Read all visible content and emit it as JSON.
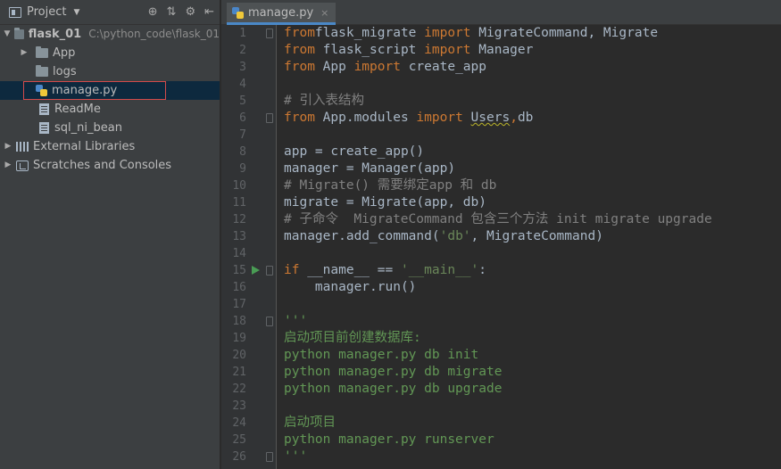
{
  "project_panel": {
    "title": "Project",
    "tools": [
      "⊕",
      "⇅",
      "⚙",
      "⇤"
    ],
    "tree": [
      {
        "label": "flask_01",
        "sub": "C:\\python_code\\flask_01",
        "type": "root"
      },
      {
        "label": "App",
        "type": "folder"
      },
      {
        "label": "logs",
        "type": "folder"
      },
      {
        "label": "manage.py",
        "type": "py",
        "selected": true
      },
      {
        "label": "ReadMe",
        "type": "file"
      },
      {
        "label": "sql_ni_bean",
        "type": "file"
      },
      {
        "label": "External Libraries",
        "type": "libs"
      },
      {
        "label": "Scratches and Consoles",
        "type": "scratches"
      }
    ]
  },
  "editor": {
    "tab": {
      "label": "manage.py",
      "close": "×"
    },
    "lines": [
      {
        "n": "1",
        "parts": [
          [
            "kw",
            "from"
          ],
          [
            "",
            "flask_migrate "
          ],
          [
            "kw",
            "import"
          ],
          [
            "",
            " MigrateCommand, Migrate"
          ]
        ]
      },
      {
        "n": "2",
        "parts": [
          [
            "kw",
            "from"
          ],
          [
            "",
            " flask_script "
          ],
          [
            "kw",
            "import"
          ],
          [
            "",
            " Manager"
          ]
        ]
      },
      {
        "n": "3",
        "parts": [
          [
            "kw",
            "from"
          ],
          [
            "",
            " App "
          ],
          [
            "kw",
            "import"
          ],
          [
            "",
            " create_app"
          ]
        ]
      },
      {
        "n": "4",
        "parts": []
      },
      {
        "n": "5",
        "parts": [
          [
            "cm",
            "# 引入表结构"
          ]
        ]
      },
      {
        "n": "6",
        "parts": [
          [
            "kw",
            "from"
          ],
          [
            "",
            " App.modules "
          ],
          [
            "kw",
            "import"
          ],
          [
            "",
            " "
          ],
          [
            "sq",
            "Users"
          ],
          [
            "kw",
            ","
          ],
          [
            "",
            "db"
          ]
        ]
      },
      {
        "n": "7",
        "parts": []
      },
      {
        "n": "8",
        "parts": [
          [
            "",
            "app = create_app()"
          ]
        ]
      },
      {
        "n": "9",
        "parts": [
          [
            "",
            "manager = Manager(app)"
          ]
        ]
      },
      {
        "n": "10",
        "parts": [
          [
            "cm",
            "# Migrate() 需要绑定app 和 db"
          ]
        ]
      },
      {
        "n": "11",
        "parts": [
          [
            "",
            "migrate = Migrate(app, db)"
          ]
        ]
      },
      {
        "n": "12",
        "parts": [
          [
            "cm",
            "# 子命令  MigrateCommand 包含三个方法 init migrate upgrade"
          ]
        ]
      },
      {
        "n": "13",
        "parts": [
          [
            "",
            "manager.add_command("
          ],
          [
            "str",
            "'db'"
          ],
          [
            "",
            ", MigrateCommand)"
          ]
        ]
      },
      {
        "n": "14",
        "parts": []
      },
      {
        "n": "15",
        "parts": [
          [
            "kw",
            "if"
          ],
          [
            "",
            " __name__ == "
          ],
          [
            "str",
            "'__main__'"
          ],
          [
            "",
            ":"
          ]
        ]
      },
      {
        "n": "16",
        "parts": [
          [
            "",
            "    manager.run()"
          ]
        ]
      },
      {
        "n": "17",
        "parts": []
      },
      {
        "n": "18",
        "parts": [
          [
            "doc",
            "'''"
          ]
        ]
      },
      {
        "n": "19",
        "parts": [
          [
            "doc",
            "启动项目前创建数据库:"
          ]
        ]
      },
      {
        "n": "20",
        "parts": [
          [
            "doc",
            "python manager.py db init"
          ]
        ]
      },
      {
        "n": "21",
        "parts": [
          [
            "doc",
            "python manager.py db migrate"
          ]
        ]
      },
      {
        "n": "22",
        "parts": [
          [
            "doc",
            "python manager.py db upgrade"
          ]
        ]
      },
      {
        "n": "23",
        "parts": []
      },
      {
        "n": "24",
        "parts": [
          [
            "doc",
            "启动项目"
          ]
        ]
      },
      {
        "n": "25",
        "parts": [
          [
            "doc",
            "python manager.py runserver"
          ]
        ]
      },
      {
        "n": "26",
        "parts": [
          [
            "doc",
            "'''"
          ]
        ]
      }
    ]
  }
}
